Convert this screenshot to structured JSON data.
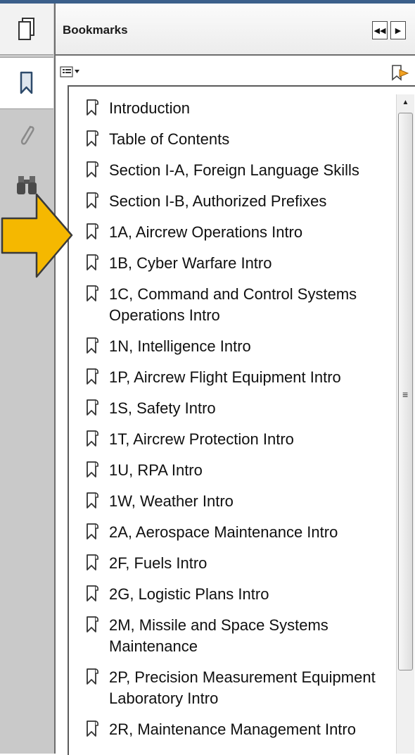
{
  "panel": {
    "title": "Bookmarks",
    "collapse_icon": "double-left-arrow-icon",
    "expand_icon": "right-arrow-icon"
  },
  "rail": {
    "tabs": [
      {
        "name": "pages-tab",
        "icon": "pages-icon"
      },
      {
        "name": "bookmarks-tab",
        "icon": "bookmark-icon",
        "selected": true
      },
      {
        "name": "attachments-tab",
        "icon": "paperclip-icon"
      },
      {
        "name": "search-tab",
        "icon": "binoculars-icon"
      }
    ]
  },
  "toolbar": {
    "options_icon": "options-menu-icon",
    "new_bookmark_icon": "new-bookmark-icon"
  },
  "bookmarks": [
    {
      "label": "Introduction"
    },
    {
      "label": "Table of Contents"
    },
    {
      "label": "Section I-A, Foreign  Language Skills"
    },
    {
      "label": "Section I-B, Authorized Prefixes"
    },
    {
      "label": "1A, Aircrew Operations Intro"
    },
    {
      "label": "1B, Cyber Warfare Intro"
    },
    {
      "label": "1C, Command and Control Systems Operations Intro"
    },
    {
      "label": "1N, Intelligence Intro"
    },
    {
      "label": "1P, Aircrew Flight Equipment Intro"
    },
    {
      "label": "1S, Safety Intro"
    },
    {
      "label": "1T, Aircrew Protection Intro"
    },
    {
      "label": "1U, RPA Intro"
    },
    {
      "label": "1W, Weather Intro"
    },
    {
      "label": "2A, Aerospace Maintenance Intro"
    },
    {
      "label": "2F, Fuels Intro"
    },
    {
      "label": "2G, Logistic Plans Intro"
    },
    {
      "label": "2M, Missile and Space Systems Maintenance"
    },
    {
      "label": "2P, Precision Measurement Equipment Laboratory Intro"
    },
    {
      "label": "2R, Maintenance Management Intro"
    }
  ],
  "annotation": {
    "icon": "pointer-arrow-icon",
    "color": "#F5B800"
  }
}
